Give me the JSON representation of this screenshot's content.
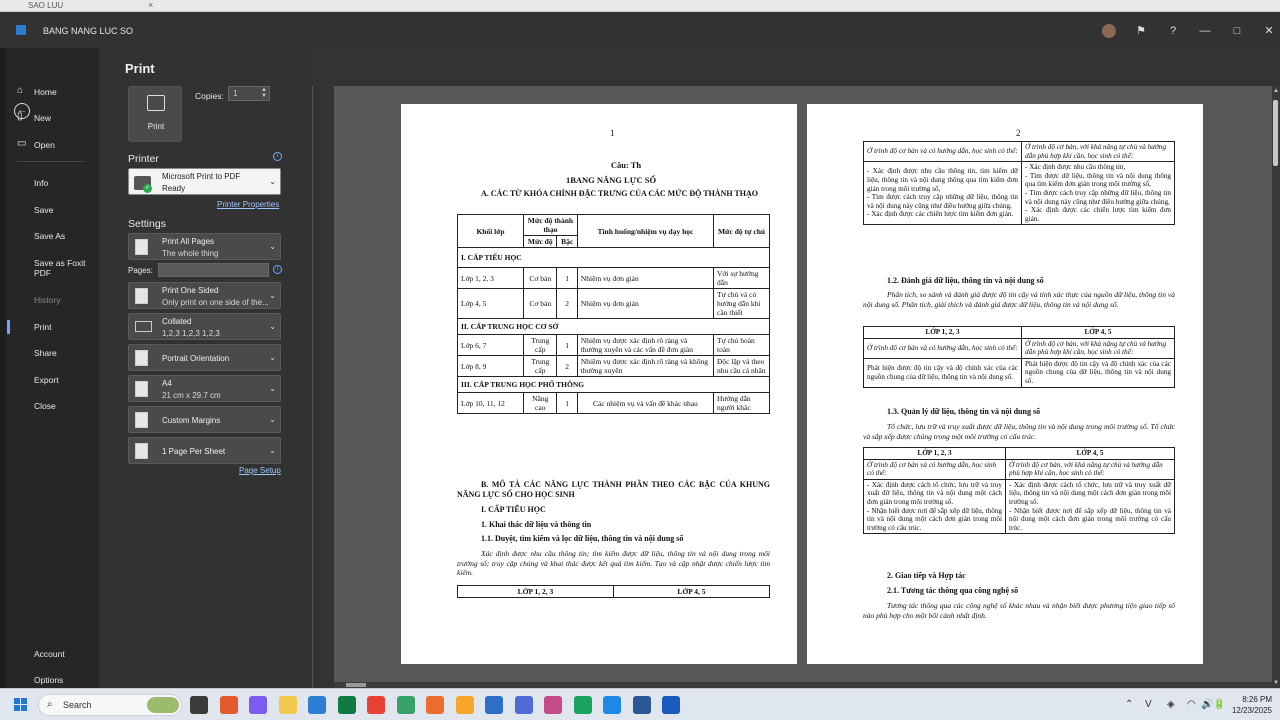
{
  "window": {
    "top_strip_title": "SAO LUU",
    "top_strip_close": "×",
    "app_title": "BANG NANG LUC SO",
    "controls": [
      "—",
      "□",
      "✕"
    ]
  },
  "sidebar": {
    "back_icon": "←",
    "items": [
      {
        "label": "Home",
        "icon": "home-icon"
      },
      {
        "label": "New",
        "icon": "new-doc-icon"
      },
      {
        "label": "Open",
        "icon": "folder-icon"
      },
      {
        "label": "Info"
      },
      {
        "label": "Save"
      },
      {
        "label": "Save As"
      },
      {
        "label": "Save as Foxit PDF"
      },
      {
        "label": "History",
        "disabled": true
      },
      {
        "label": "Print",
        "active": true
      },
      {
        "label": "Share"
      },
      {
        "label": "Export"
      },
      {
        "label": "Close"
      }
    ],
    "bottom": [
      {
        "label": "Account"
      },
      {
        "label": "Options"
      }
    ]
  },
  "print": {
    "title": "Print",
    "print_button": "Print",
    "copies_label": "Copies:",
    "copies_value": "1",
    "printer_heading": "Printer",
    "printer_name": "Microsoft Print to PDF",
    "printer_status": "Ready",
    "printer_properties": "Printer Properties",
    "settings_heading": "Settings",
    "pages_label": "Pages:",
    "settings": [
      {
        "l1": "Print All Pages",
        "l2": "The whole thing"
      },
      {
        "l1": "Print One Sided",
        "l2": "Only print on one side of the..."
      },
      {
        "l1": "Collated",
        "l2": "1,2,3    1,2,3    1,2,3"
      },
      {
        "l1": "Portrait Orientation",
        "l2": ""
      },
      {
        "l1": "A4",
        "l2": "21 cm x 29.7 cm"
      },
      {
        "l1": "Custom Margins",
        "l2": ""
      },
      {
        "l1": "1 Page Per Sheet",
        "l2": ""
      }
    ],
    "page_setup": "Page Setup"
  },
  "page1": {
    "number": "1",
    "cau": "Câu: Th",
    "title": "1BANG NĂNG LỰC SỐ",
    "heading_a": "A. CÁC TỪ KHÓA CHÍNH ĐẶC TRƯNG CỦA CÁC MỨC ĐỘ THÀNH THẠO",
    "table_headers": [
      "Khối lớp",
      "Mức độ thành thạo",
      "Tình huống/nhiệm vụ dạy học",
      "Mức độ tự chủ"
    ],
    "sub_headers": [
      "Mức độ",
      "Bậc"
    ],
    "sections": [
      {
        "title": "I. CẤP TIỂU HỌC",
        "rows": [
          [
            "Lớp 1, 2, 3",
            "Cơ bản",
            "1",
            "Nhiệm vụ đơn giản",
            "Với sự hướng dẫn"
          ],
          [
            "Lớp 4, 5",
            "Cơ bản",
            "2",
            "Nhiệm vụ đơn giản",
            "Tự chủ và có hướng dẫn khi cần thiết"
          ]
        ]
      },
      {
        "title": "II. CẤP TRUNG HỌC CƠ SỞ",
        "rows": [
          [
            "Lớp 6, 7",
            "Trung cấp",
            "1",
            "Nhiệm vụ được xác định rõ ràng và thường xuyên và các vấn đề đơn giản",
            "Tự chủ hoàn toàn"
          ],
          [
            "Lớp 8, 9",
            "Trung cấp",
            "2",
            "Nhiệm vụ được xác định rõ ràng và không thường xuyên",
            "Độc lập và theo nhu cầu cá nhân"
          ]
        ]
      },
      {
        "title": "III. CẤP TRUNG HỌC PHỔ THÔNG",
        "rows": [
          [
            "Lớp 10, 11, 12",
            "Nâng cao",
            "1",
            "Các nhiệm vụ và vấn đề khác nhau",
            "Hướng dẫn người khác"
          ]
        ]
      }
    ],
    "heading_b": "B. MÔ TẢ CÁC NĂNG LỰC THÀNH PHẦN THEO CÁC BẬC CỦA KHUNG NĂNG LỰC SỐ CHO HỌC SINH",
    "l1": "I. CẤP TIỂU HỌC",
    "l2": "1. Khai thác dữ liệu và thông tin",
    "l3": "1.1. Duyệt, tìm kiếm và lọc dữ liệu, thông tin và nội dung số",
    "para": "Xác định được nhu cầu thông tin; tìm kiếm được dữ liệu, thông tin và nội dung trong môi trường số; truy cập chúng và khai thác được kết quả tìm kiếm. Tạo và cập nhật được chiến lược tìm kiếm.",
    "foot_headers": [
      "LỚP 1, 2, 3",
      "LỚP 4, 5"
    ]
  },
  "page2": {
    "number": "2",
    "t1": {
      "r1": [
        "Ở trình độ cơ bản và có hướng dẫn, học sinh có thể:",
        "Ở trình độ cơ bản, với khả năng tự chủ và hướng dẫn phù hợp khi cần, học sinh có thể:"
      ],
      "r2": [
        "- Xác định được nhu cầu thông tin, tìm kiếm dữ liệu, thông tin và nội dung thông qua tìm kiếm đơn giản trong môi trường số,\n- Tìm được cách truy cập những dữ liệu, thông tin và nội dung này cũng như điều hướng giữa chúng,\n- Xác định được các chiến lược tìm kiếm đơn giản.",
        "- Xác định được nhu cầu thông tin,\n- Tìm được dữ liệu, thông tin và nội dung thông qua tìm kiếm đơn giản trong môi trường số,\n- Tìm được cách truy cập những dữ liệu, thông tin và nội dung này cũng như điều hướng giữa chúng,\n- Xác định được các chiến lược tìm kiếm đơn giản."
      ]
    },
    "h12": "1.2. Đánh giá dữ liệu, thông tin và nội dung số",
    "p12": "Phân tích, so sánh và đánh giá được độ tin cậy và tính xác thực của nguồn dữ liệu, thông tin và nội dung số. Phân tích, giải thích và đánh giá được dữ liệu, thông tin và nội dung số.",
    "t2": {
      "h": [
        "LỚP 1, 2, 3",
        "LỚP 4, 5"
      ],
      "r1": [
        "Ở trình độ cơ bản và có hướng dẫn, học sinh có thể:",
        "Ở trình độ cơ bản, với khả năng tự chủ và hướng dẫn phù hợp khi cần, học sinh có thể:"
      ],
      "r2": [
        "Phát hiện được độ tin cậy và độ chính xác của các nguồn chung của dữ liệu, thông tin và nội dung số.",
        "Phát hiện được độ tin cậy và độ chính xác của các nguồn chung của dữ liệu, thông tin và nội dung số."
      ]
    },
    "h13": "1.3. Quản lý dữ liệu, thông tin và nội dung số",
    "p13": "Tổ chức, lưu trữ và truy xuất được dữ liệu, thông tin và nội dung trong môi trường số. Tổ chức và sắp xếp được chúng trong một môi trường có cấu trúc.",
    "t3": {
      "h": [
        "LỚP 1, 2, 3",
        "LỚP 4, 5"
      ],
      "r1": [
        "Ở trình độ cơ bản và có hướng dẫn, học sinh có thể:",
        "Ở trình độ cơ bản, với khả năng tự chủ và hướng dẫn phù hợp khi cần, học sinh có thể:"
      ],
      "r2": [
        "- Xác định được cách tổ chức, lưu trữ và truy xuất dữ liệu, thông tin và nội dung một cách đơn giản trong môi trường số.\n- Nhận biết được nơi để sắp xếp dữ liệu, thông tin và nội dung một cách đơn giản trong môi trường có cấu trúc.",
        "- Xác định được cách tổ chức, lưu trữ và truy xuất dữ liệu, thông tin và nội dung một cách đơn giản trong môi trường số.\n- Nhận biết được nơi để sắp xếp dữ liệu, thông tin và nội dung một cách đơn giản trong môi trường có cấu trúc."
      ]
    },
    "h2": "2. Giao tiếp và Hợp tác",
    "h21": "2.1. Tương tác thông qua công nghệ số",
    "p21": "Tương tác thông qua các công nghệ số khác nhau và nhận biết được phương tiện giao tiếp số nào phù hợp cho một bối cảnh nhất định."
  },
  "taskbar": {
    "search": "Search",
    "time": "8:26 PM",
    "date": "12/23/2025",
    "apps": [
      "#3b3b3b",
      "#e35b2c",
      "#7c5cf0",
      "#f2c94c",
      "#2d7fd3",
      "#0f7b3f",
      "#e94235",
      "#38a169",
      "#ed6c30",
      "#f7a52b",
      "#2f6ec8",
      "#4f6bd6",
      "#c44a8a",
      "#1aa260",
      "#1e88e5",
      "#2b5797",
      "#185abd"
    ],
    "tray": [
      "⌃",
      "V",
      "◈",
      "◠",
      "🔊",
      "🔋"
    ]
  }
}
